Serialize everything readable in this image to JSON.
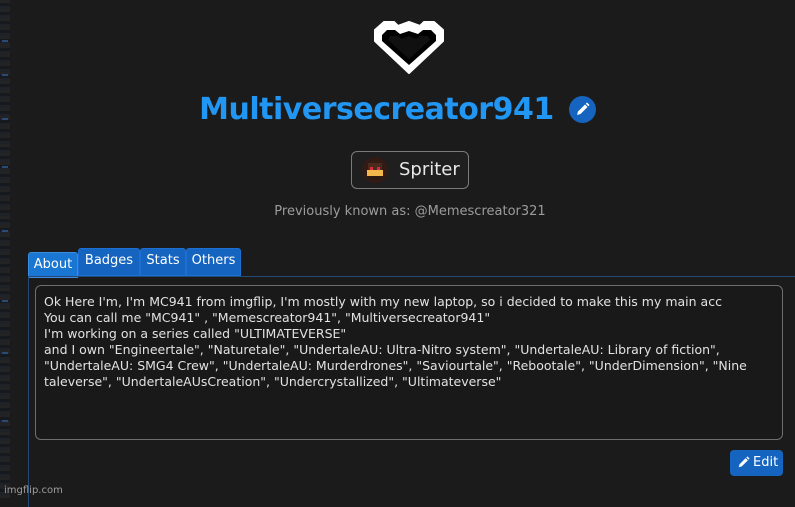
{
  "profile": {
    "username": "Multiversecreator941",
    "role": "Spriter",
    "previously_known": "Previously known as: @Memescreator321"
  },
  "tabs": [
    {
      "label": "About",
      "active": true
    },
    {
      "label": "Badges",
      "active": false
    },
    {
      "label": "Stats",
      "active": false
    },
    {
      "label": "Others",
      "active": false
    }
  ],
  "bio": {
    "lines": [
      "Ok Here I'm, I'm MC941 from imgflip, I'm mostly with my new laptop, so i decided to make this my main acc",
      "You can call me \"MC941\" , \"Memescreator941\", \"Multiversecreator941\"",
      "",
      "I'm working on a series called \"ULTIMATEVERSE\"",
      "",
      "and I own \"Engineertale\", \"Naturetale\", \"UndertaleAU: Ultra-Nitro system\", \"UndertaleAU: Library of fiction\",",
      "\"UndertaleAU: SMG4 Crew\", \"UndertaleAU: Murderdrones\", \"Saviourtale\", \"Rebootale\", \"UnderDimension\", \"Nine",
      "taleverse\", \"UndertaleAUsCreation\", \"Undercrystallized\", \"Ultimateverse\""
    ]
  },
  "actions": {
    "edit_label": "Edit"
  },
  "watermark": "imgflip.com",
  "colors": {
    "accent": "#2196f3",
    "button": "#1565c0",
    "background": "#1b1b1b"
  },
  "icons": {
    "logo": "heart-logo-icon",
    "edit_name": "pencil-icon",
    "edit": "pencil-icon"
  }
}
